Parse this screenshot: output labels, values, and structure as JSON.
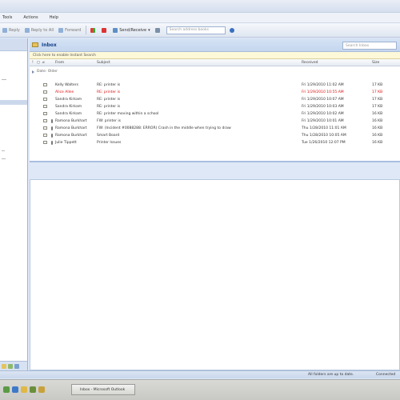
{
  "menubar": {
    "items": [
      "Tools",
      "Actions",
      "Help"
    ]
  },
  "toolbar": {
    "reply": "Reply",
    "reply_all": "Reply to All",
    "forward": "Forward",
    "send_receive": "Send/Receive",
    "search_books_placeholder": "Search address books"
  },
  "inbox": {
    "title": "Inbox",
    "search_placeholder": "Search Inbox",
    "infobar": "Click here to enable Instant Search"
  },
  "columns": {
    "from": "From",
    "subject": "Subject",
    "received": "Received",
    "size": "Size"
  },
  "group": {
    "label": "Date: Older"
  },
  "messages": [
    {
      "from": "Kelly Walters",
      "subject": "RE: printer is",
      "received": "Fri 1/29/2010 11:02 AM",
      "size": "17 KB",
      "red": false
    },
    {
      "from": "Alice Allen",
      "subject": "RE: printer is",
      "received": "Fri 1/29/2010 10:55 AM",
      "size": "17 KB",
      "red": true
    },
    {
      "from": "Sandra Kirkam",
      "subject": "RE: printer is",
      "received": "Fri 1/29/2010 10:07 AM",
      "size": "17 KB",
      "red": false
    },
    {
      "from": "Sandra Kirkam",
      "subject": "RE: printer is",
      "received": "Fri 1/29/2010 10:03 AM",
      "size": "17 KB",
      "red": false
    },
    {
      "from": "Sandra Kirkam",
      "subject": "RE: printer moving within a school",
      "received": "Fri 1/29/2010 10:02 AM",
      "size": "16 KB",
      "red": false
    },
    {
      "from": "Ramona Burkhart",
      "subject": "FW: printer is",
      "received": "Fri 1/29/2010 10:01 AM",
      "size": "16 KB",
      "red": false
    },
    {
      "from": "Ramona Burkhart",
      "subject": "FW: (Incident #0088288: ERROR) Crash in the middle when trying to draw",
      "received": "Thu 1/28/2010 11:01 AM",
      "size": "16 KB",
      "red": false
    },
    {
      "from": "Ramona Burkhart",
      "subject": "Smart Board",
      "received": "Thu 1/28/2010 10:05 AM",
      "size": "16 KB",
      "red": false
    },
    {
      "from": "Julie Tippett",
      "subject": "Printer Issues",
      "received": "Tue 1/26/2010 12:07 PM",
      "size": "16 KB",
      "red": false
    }
  ],
  "statusbar": {
    "sync": "All folders are up to date.",
    "connection": "Connected"
  },
  "taskbar": {
    "button": "Inbox - Microsoft Outlook"
  }
}
